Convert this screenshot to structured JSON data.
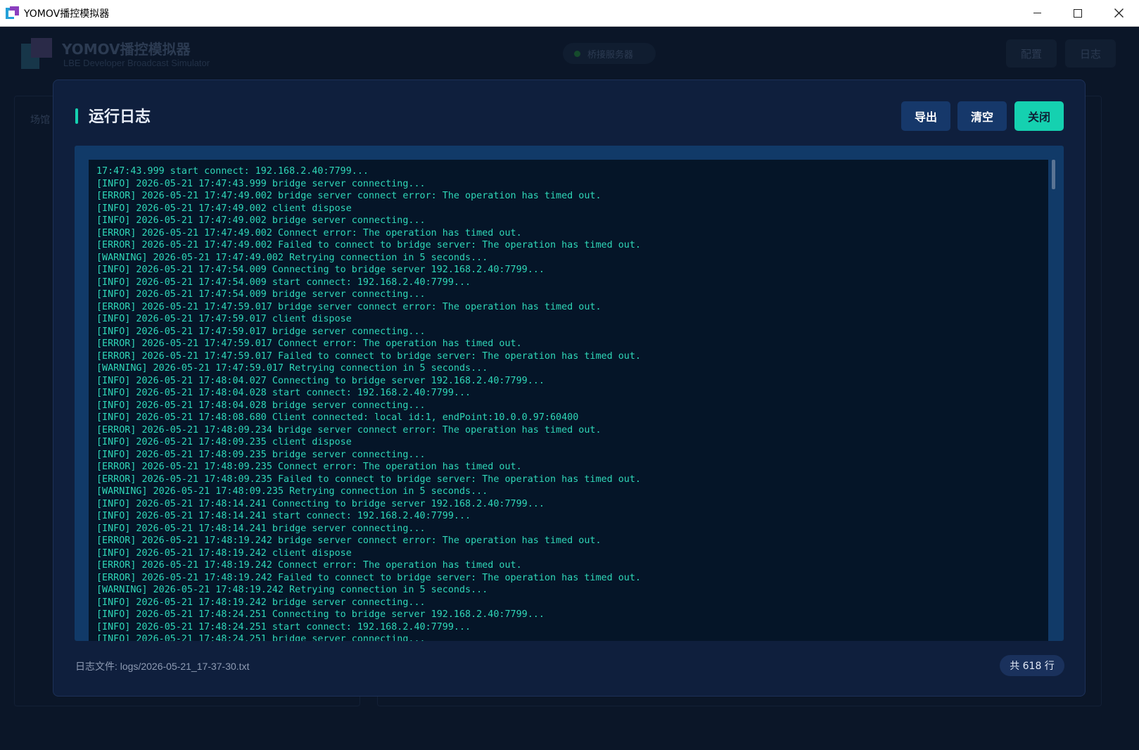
{
  "window": {
    "title": "YOMOV播控模拟器",
    "controls": [
      "minimize",
      "maximize",
      "close"
    ]
  },
  "background_app": {
    "app_name": "YOMOV播控模拟器",
    "app_subtitle": "LBE Developer Broadcast Simulator",
    "status_label": "桥接服务器",
    "config_label": "配置",
    "log_label": "日志",
    "venue_label": "场馆"
  },
  "modal": {
    "title": "运行日志",
    "export_label": "导出",
    "clear_label": "清空",
    "close_label": "关闭",
    "log_file": "日志文件: logs/2026-05-21_17-37-30.txt",
    "line_count": "共 618 行",
    "lines": [
      "17:47:43.999 start connect: 192.168.2.40:7799...",
      "[INFO] 2026-05-21 17:47:43.999 bridge server connecting...",
      "[ERROR] 2026-05-21 17:47:49.002 bridge server connect error: The operation has timed out.",
      "[INFO] 2026-05-21 17:47:49.002 client dispose",
      "[INFO] 2026-05-21 17:47:49.002 bridge server connecting...",
      "[ERROR] 2026-05-21 17:47:49.002 Connect error: The operation has timed out.",
      "[ERROR] 2026-05-21 17:47:49.002 Failed to connect to bridge server: The operation has timed out.",
      "[WARNING] 2026-05-21 17:47:49.002 Retrying connection in 5 seconds...",
      "[INFO] 2026-05-21 17:47:54.009 Connecting to bridge server 192.168.2.40:7799...",
      "[INFO] 2026-05-21 17:47:54.009 start connect: 192.168.2.40:7799...",
      "[INFO] 2026-05-21 17:47:54.009 bridge server connecting...",
      "[ERROR] 2026-05-21 17:47:59.017 bridge server connect error: The operation has timed out.",
      "[INFO] 2026-05-21 17:47:59.017 client dispose",
      "[INFO] 2026-05-21 17:47:59.017 bridge server connecting...",
      "[ERROR] 2026-05-21 17:47:59.017 Connect error: The operation has timed out.",
      "[ERROR] 2026-05-21 17:47:59.017 Failed to connect to bridge server: The operation has timed out.",
      "[WARNING] 2026-05-21 17:47:59.017 Retrying connection in 5 seconds...",
      "[INFO] 2026-05-21 17:48:04.027 Connecting to bridge server 192.168.2.40:7799...",
      "[INFO] 2026-05-21 17:48:04.028 start connect: 192.168.2.40:7799...",
      "[INFO] 2026-05-21 17:48:04.028 bridge server connecting...",
      "[INFO] 2026-05-21 17:48:08.680 Client connected: local id:1, endPoint:10.0.0.97:60400",
      "[ERROR] 2026-05-21 17:48:09.234 bridge server connect error: The operation has timed out.",
      "[INFO] 2026-05-21 17:48:09.235 client dispose",
      "[INFO] 2026-05-21 17:48:09.235 bridge server connecting...",
      "[ERROR] 2026-05-21 17:48:09.235 Connect error: The operation has timed out.",
      "[ERROR] 2026-05-21 17:48:09.235 Failed to connect to bridge server: The operation has timed out.",
      "[WARNING] 2026-05-21 17:48:09.235 Retrying connection in 5 seconds...",
      "[INFO] 2026-05-21 17:48:14.241 Connecting to bridge server 192.168.2.40:7799...",
      "[INFO] 2026-05-21 17:48:14.241 start connect: 192.168.2.40:7799...",
      "[INFO] 2026-05-21 17:48:14.241 bridge server connecting...",
      "[ERROR] 2026-05-21 17:48:19.242 bridge server connect error: The operation has timed out.",
      "[INFO] 2026-05-21 17:48:19.242 client dispose",
      "[ERROR] 2026-05-21 17:48:19.242 Connect error: The operation has timed out.",
      "[ERROR] 2026-05-21 17:48:19.242 Failed to connect to bridge server: The operation has timed out.",
      "[WARNING] 2026-05-21 17:48:19.242 Retrying connection in 5 seconds...",
      "[INFO] 2026-05-21 17:48:19.242 bridge server connecting...",
      "[INFO] 2026-05-21 17:48:24.251 Connecting to bridge server 192.168.2.40:7799...",
      "[INFO] 2026-05-21 17:48:24.251 start connect: 192.168.2.40:7799...",
      "[INFO] 2026-05-21 17:48:24.251 bridge server connecting..."
    ]
  },
  "colors": {
    "accent": "#15d1b0",
    "log_text": "#2fd7b8",
    "modal_bg": "#0f1f3d",
    "button_bg": "#16386a"
  }
}
